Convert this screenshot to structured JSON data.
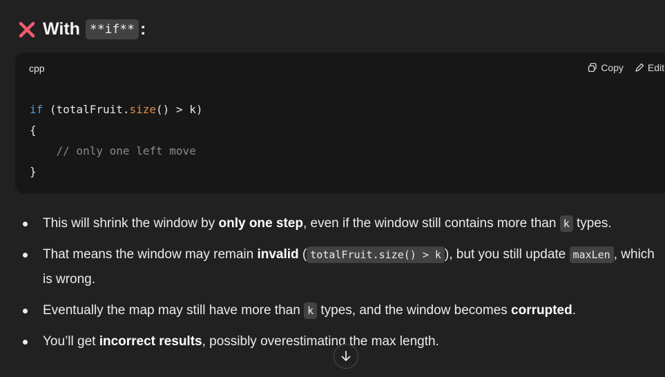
{
  "heading": {
    "prefix": "With",
    "code": "**if**",
    "suffix": ":",
    "icon": "cross-mark-icon",
    "icon_color": "#f25a6e"
  },
  "code_block": {
    "language": "cpp",
    "copy_label": "Copy",
    "edit_label": "Edit",
    "lines": [
      {
        "kw": "if",
        "pre": " (totalFruit.",
        "fn": "size",
        "post": "() > k)"
      },
      {
        "text": "{"
      },
      {
        "comment": "    // only one left move"
      },
      {
        "text": "}"
      }
    ]
  },
  "bullets": [
    {
      "parts": [
        "This will shrink the window by ",
        "only one step",
        ", even if the window still contains more than ",
        "k",
        " types."
      ]
    },
    {
      "parts": [
        "That means the window may remain ",
        "invalid",
        " (",
        "totalFruit.size() > k",
        "), but you still update ",
        "maxLen",
        ", which is wrong."
      ]
    },
    {
      "parts": [
        "Eventually the map may still have more than ",
        "k",
        " types, and the window becomes ",
        "corrupted",
        "."
      ]
    },
    {
      "parts": [
        "You’ll get ",
        "incorrect results",
        ", possibly overestimating the max length."
      ]
    }
  ],
  "scroll_button": {
    "icon": "arrow-down-icon"
  }
}
